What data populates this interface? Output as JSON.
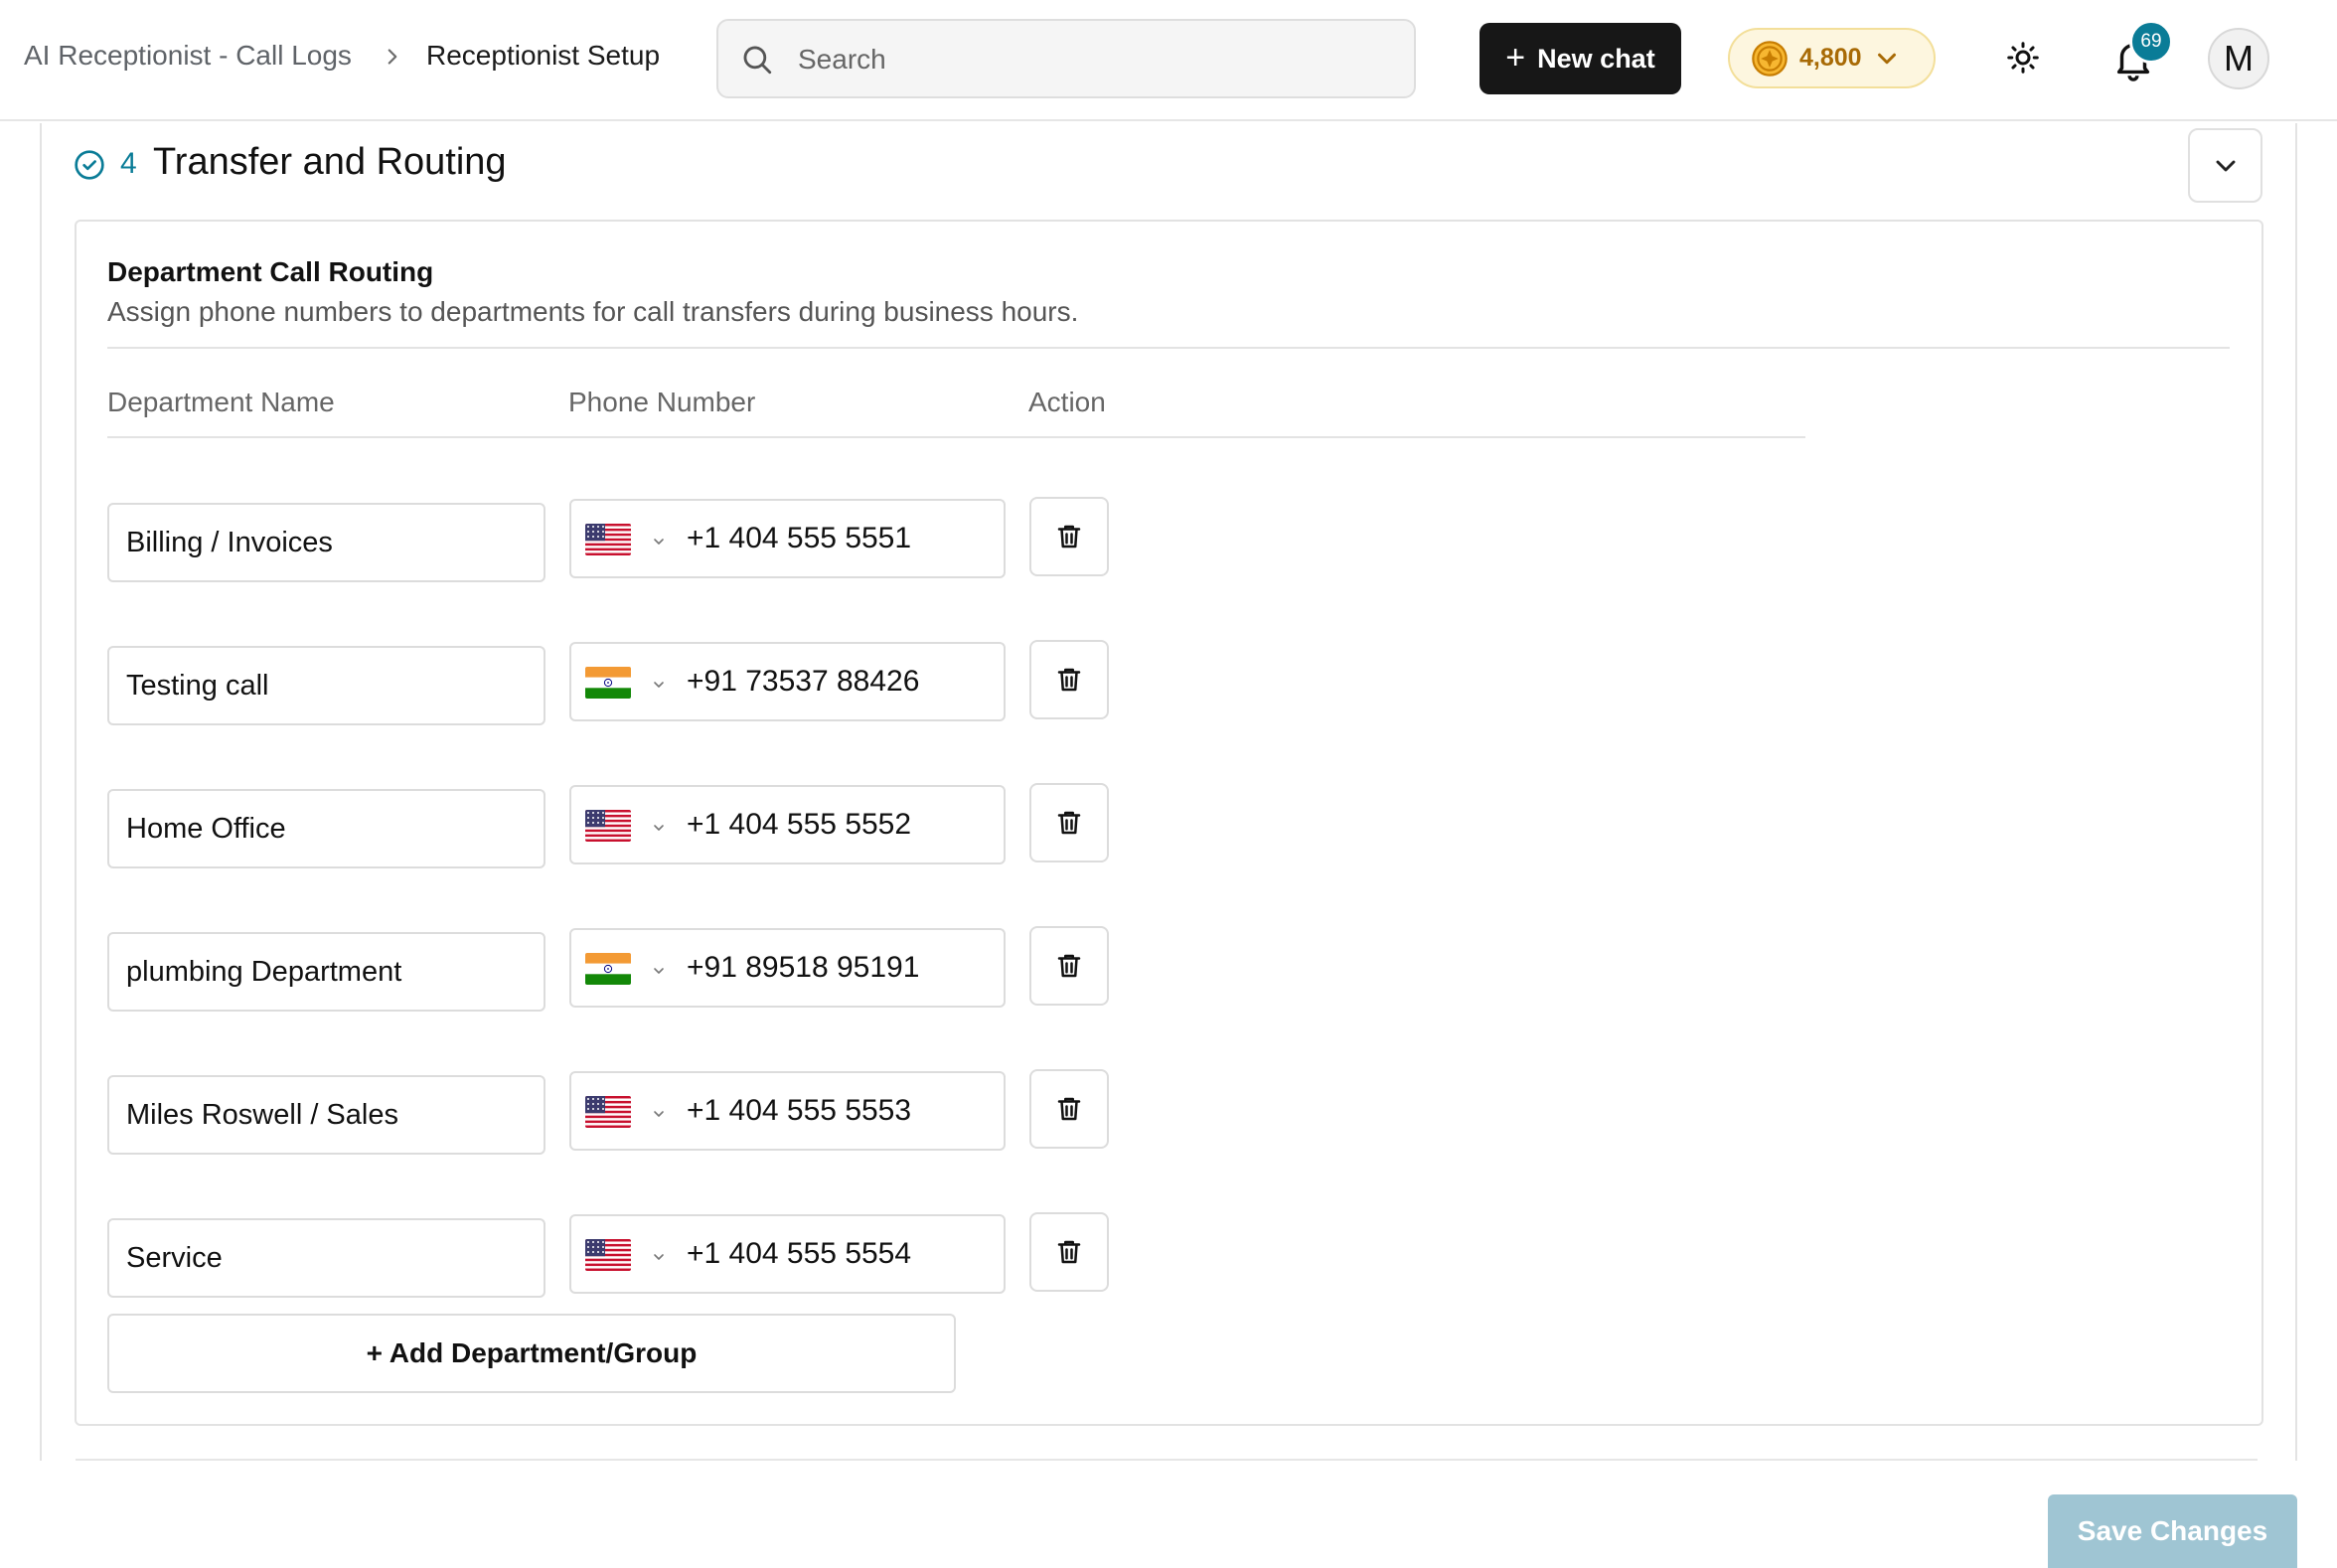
{
  "header": {
    "breadcrumb": [
      "AI Receptionist - Call Logs",
      "Receptionist Setup"
    ],
    "search": {
      "placeholder": "Search",
      "value": ""
    },
    "new_chat_label": "New chat",
    "credits": "4,800",
    "notification_count": "69",
    "avatar_initial": "M"
  },
  "section": {
    "number": "4",
    "title": "Transfer and Routing",
    "status_icon": "check-circle-icon"
  },
  "card": {
    "title": "Department Call Routing",
    "subtitle": "Assign phone numbers to departments for call transfers during business hours.",
    "columns": [
      "Department Name",
      "Phone Number",
      "Action"
    ],
    "rows": [
      {
        "department": "Billing / Invoices",
        "flag": "us",
        "phone": "+1 404 555 5551"
      },
      {
        "department": "Testing call",
        "flag": "in",
        "phone": "+91 73537 88426"
      },
      {
        "department": "Home Office",
        "flag": "us",
        "phone": "+1 404 555 5552"
      },
      {
        "department": "plumbing Department",
        "flag": "in",
        "phone": "+91 89518 95191"
      },
      {
        "department": "Miles Roswell / Sales",
        "flag": "us",
        "phone": "+1 404 555 5553"
      },
      {
        "department": "Service",
        "flag": "us",
        "phone": "+1 404 555 5554"
      }
    ],
    "add_label": "+ Add Department/Group"
  },
  "footer": {
    "save_label": "Save Changes"
  },
  "colors": {
    "accent": "#0a7c97",
    "primary_button": "#171717",
    "credits_text": "#a86a05",
    "save_disabled": "#9fc5d3"
  }
}
